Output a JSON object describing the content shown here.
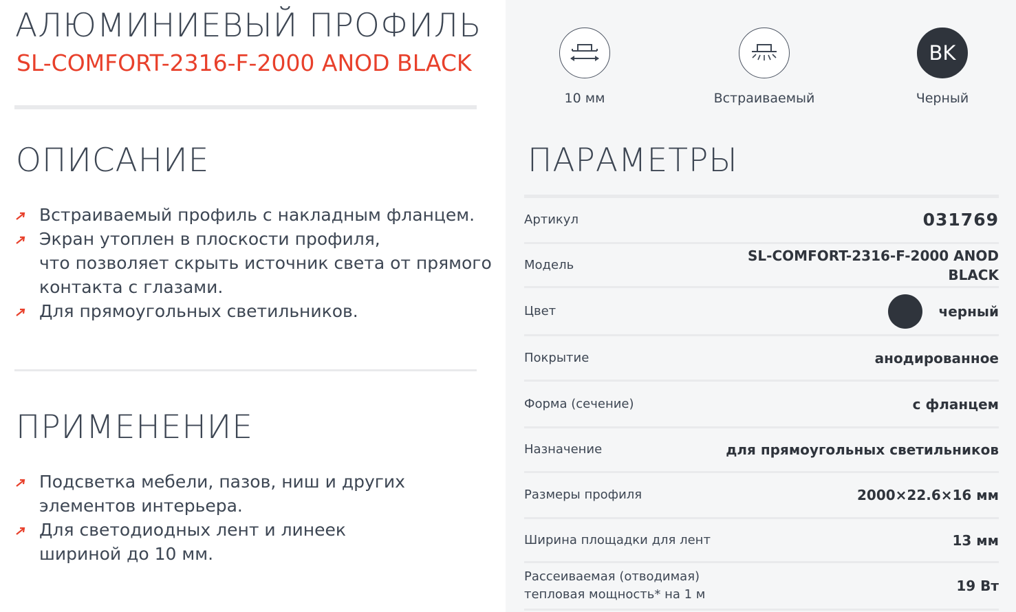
{
  "header": {
    "title": "АЛЮМИНИЕВЫЙ ПРОФИЛЬ",
    "model": "SL-COMFORT-2316-F-2000 ANOD BLACK"
  },
  "description": {
    "heading": "ОПИСАНИЕ",
    "items": [
      {
        "lines": [
          "Встраиваемый профиль с накладным фланцем."
        ]
      },
      {
        "lines": [
          "Экран утоплен в плоскости профиля,",
          "что позволяет скрыть источник света от прямого",
          "контакта с глазами."
        ]
      },
      {
        "lines": [
          "Для прямоугольных светильников."
        ]
      }
    ]
  },
  "application": {
    "heading": "ПРИМЕНЕНИЕ",
    "items": [
      {
        "lines": [
          "Подсветка мебели, пазов, ниш и других",
          "элементов интерьера."
        ]
      },
      {
        "lines": [
          "Для светодиодных лент и линеек",
          "шириной до 10 мм."
        ]
      }
    ]
  },
  "features": [
    {
      "icon": "profile-width-icon",
      "label": "10 мм"
    },
    {
      "icon": "recessed-mount-icon",
      "label": "Встраиваемый"
    },
    {
      "icon": "color-code-badge",
      "badge": "BK",
      "label": "Черный"
    }
  ],
  "parameters": {
    "heading": "ПАРАМЕТРЫ",
    "rows": [
      {
        "label": "Артикул",
        "value": "031769"
      },
      {
        "label": "Модель",
        "value": "SL-COMFORT-2316-F-2000 ANOD BLACK"
      },
      {
        "label": "Цвет",
        "value": "черный",
        "swatch": "#2f343c"
      },
      {
        "label": "Покрытие",
        "value": "анодированное"
      },
      {
        "label": "Форма (сечение)",
        "value": "с фланцем"
      },
      {
        "label": "Назначение",
        "value": "для прямоугольных светильников"
      },
      {
        "label": "Размеры профиля",
        "value": "2000×22.6×16 мм"
      },
      {
        "label": "Ширина площадки для лент",
        "value": "13 мм"
      },
      {
        "label": "Рассеиваемая (отводимая)\nтепловая мощность* на 1 м",
        "label_lines": [
          "Рассеиваемая (отводимая)",
          "тепловая мощность* на 1 м"
        ],
        "value": "19 Вт"
      }
    ]
  },
  "colors": {
    "accent": "#e8402b",
    "text": "#3d4653",
    "panel": "#f5f6f7",
    "divider": "#e9eaec"
  }
}
